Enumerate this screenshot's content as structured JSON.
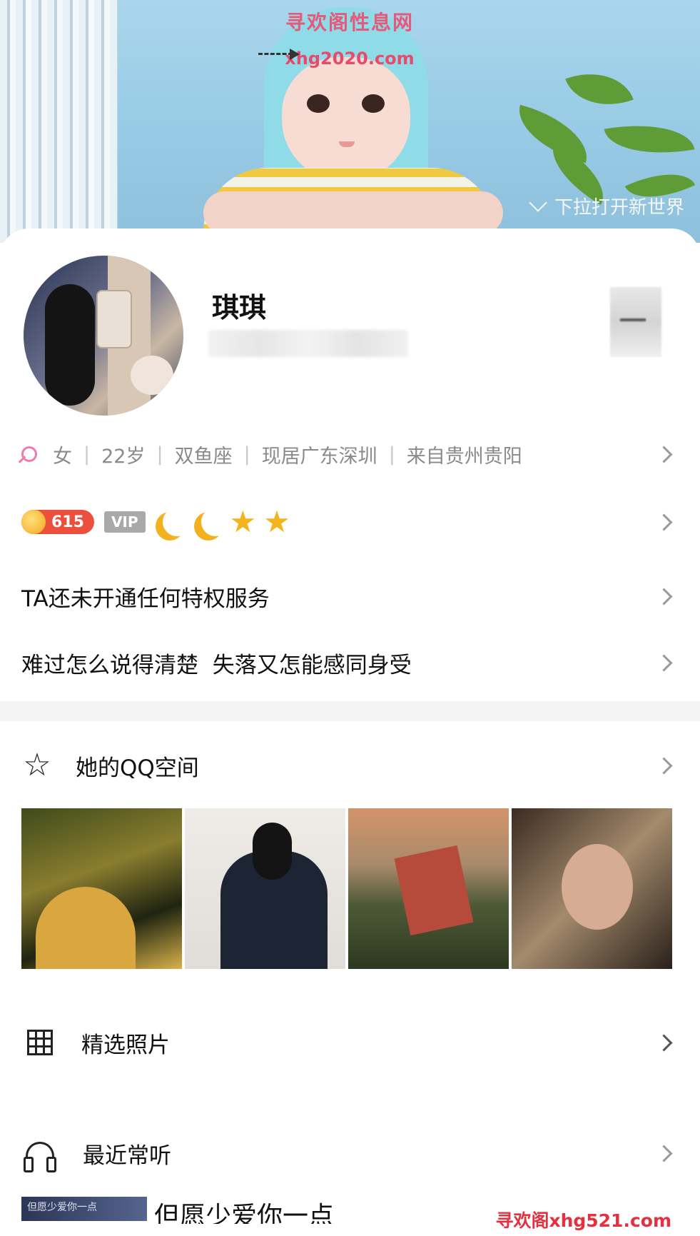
{
  "banner": {
    "watermark_top_line1": "寻欢阁性息网",
    "watermark_top_line2": "xhg2020.com",
    "pull_hint": "下拉打开新世界"
  },
  "profile": {
    "name": "琪琪",
    "info": [
      "女",
      "22岁",
      "双鱼座",
      "现居广东深圳",
      "来自贵州贵阳"
    ]
  },
  "badges": {
    "coin_count": "615",
    "vip_label": "VIP",
    "level_icons": [
      "moon-icon",
      "moon-icon",
      "star-icon",
      "star-icon"
    ]
  },
  "rows": {
    "privilege": "TA还未开通任何特权服务",
    "signature": "难过怎么说得清楚  失落又怎能感同身受",
    "qzone": "她的QQ空间",
    "featured_photos": "精选照片",
    "recent_music": "最近常听"
  },
  "song": {
    "thumb_text": "但愿少爱你一点",
    "title": "但愿少爱你一点"
  },
  "watermark_bottom": "寻欢阁xhg521.com",
  "colors": {
    "coin_badge": "#ec4f3c",
    "vip_badge": "#a9a9a9",
    "gender_icon": "#f07bb0",
    "level_gold": "#f2b21f",
    "watermark": "#e6303f"
  }
}
